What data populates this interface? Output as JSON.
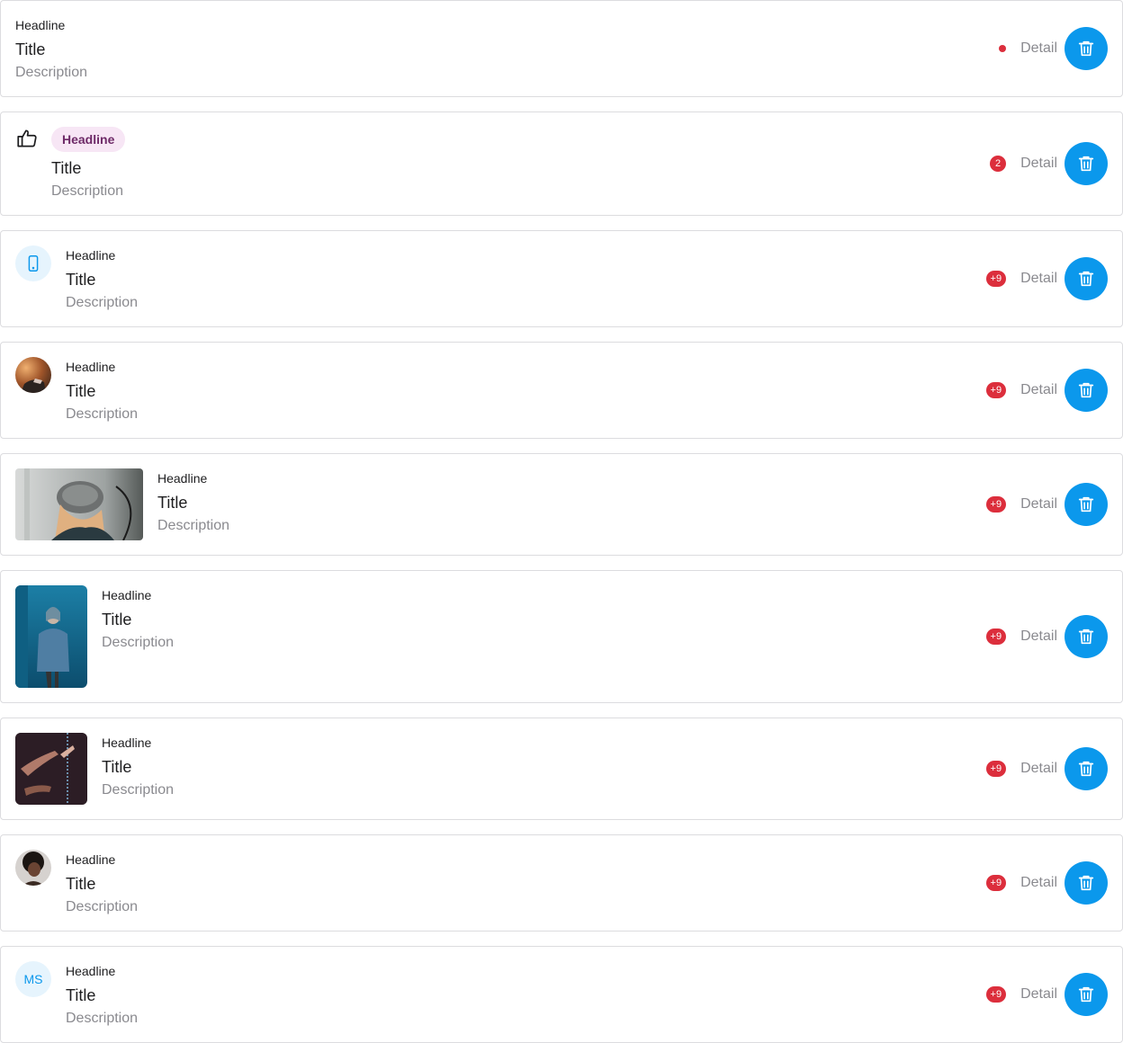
{
  "colors": {
    "accent": "#0b98ec",
    "badge": "#dc2e3c",
    "chip_bg": "#f7e6f5",
    "chip_text": "#6e2a68"
  },
  "items": [
    {
      "leading": "none",
      "headline": "Headline",
      "title": "Title",
      "description": "Description",
      "indicator": "dot",
      "detail": "Detail",
      "action_icon": "trash-icon"
    },
    {
      "leading": "thumb-up-icon",
      "headline": "Headline",
      "title": "Title",
      "description": "Description",
      "indicator": "badge",
      "badge": "2",
      "detail": "Detail",
      "action_icon": "trash-icon"
    },
    {
      "leading": "phone-icon",
      "headline": "Headline",
      "title": "Title",
      "description": "Description",
      "indicator": "badge",
      "badge": "+9",
      "detail": "Detail",
      "action_icon": "trash-icon"
    },
    {
      "leading": "avatar-photo",
      "headline": "Headline",
      "title": "Title",
      "description": "Description",
      "indicator": "badge",
      "badge": "+9",
      "detail": "Detail",
      "action_icon": "trash-icon"
    },
    {
      "leading": "landscape-photo",
      "headline": "Headline",
      "title": "Title",
      "description": "Description",
      "indicator": "badge",
      "badge": "+9",
      "detail": "Detail",
      "action_icon": "trash-icon"
    },
    {
      "leading": "portrait-photo",
      "headline": "Headline",
      "title": "Title",
      "description": "Description",
      "indicator": "badge",
      "badge": "+9",
      "detail": "Detail",
      "action_icon": "trash-icon"
    },
    {
      "leading": "square-photo",
      "headline": "Headline",
      "title": "Title",
      "description": "Description",
      "indicator": "badge",
      "badge": "+9",
      "detail": "Detail",
      "action_icon": "trash-icon"
    },
    {
      "leading": "avatar-photo",
      "headline": "Headline",
      "title": "Title",
      "description": "Description",
      "indicator": "badge",
      "badge": "+9",
      "detail": "Detail",
      "action_icon": "trash-icon"
    },
    {
      "leading": "initials",
      "initials": "MS",
      "headline": "Headline",
      "title": "Title",
      "description": "Description",
      "indicator": "badge",
      "badge": "+9",
      "detail": "Detail",
      "action_icon": "trash-icon"
    }
  ]
}
